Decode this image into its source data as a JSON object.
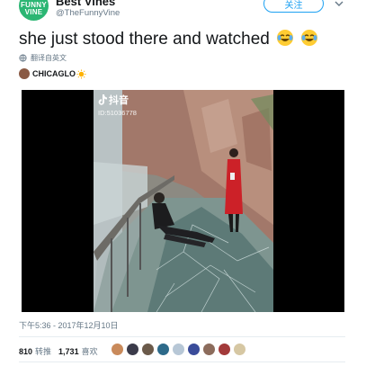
{
  "author": {
    "name": "Best Vines",
    "handle": "@TheFunnyVine",
    "logo_line1": "FUNNY",
    "logo_line2": "VINE"
  },
  "follow_label": "关注",
  "tweet": {
    "text": "she just stood there and watched",
    "emojis": [
      "face-with-tears-of-joy",
      "face-with-tears-of-joy"
    ]
  },
  "translate_label": "翻译自英文",
  "credit": {
    "name": "CHICAGLO",
    "emoji": "sun"
  },
  "video": {
    "watermark_app": "抖音",
    "watermark_id": "ID:51036778"
  },
  "timestamp": "下午5:36 - 2017年12月10日",
  "stats": {
    "retweets": "810",
    "retweets_label": "转推",
    "likes": "1,731",
    "likes_label": "喜欢"
  },
  "colors": {
    "brand_green": "#2bb673",
    "twitter_blue": "#1da1f2",
    "muted_text": "#657786"
  }
}
